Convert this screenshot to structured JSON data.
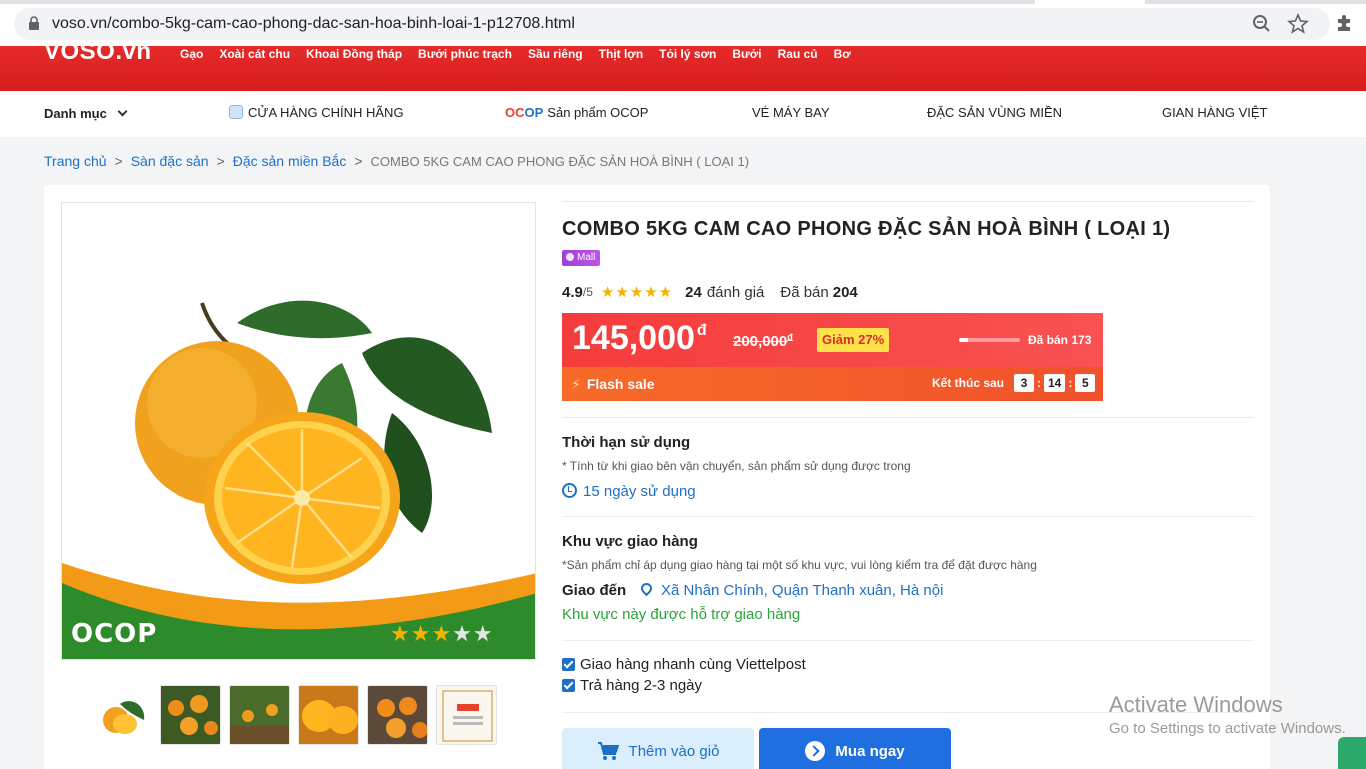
{
  "browser": {
    "url": "voso.vn/combo-5kg-cam-cao-phong-dac-san-hoa-binh-loai-1-p12708.html",
    "icons": [
      "lock-icon",
      "zoom-icon",
      "star-bookmark-icon",
      "extension-puzzle-icon"
    ]
  },
  "header": {
    "logo": "VOSO.vn",
    "links": [
      "Gạo",
      "Xoài cát chu",
      "Khoai Đồng tháp",
      "Bưởi phúc trạch",
      "Sầu riêng",
      "Thịt lợn",
      "Tỏi lý sơn",
      "Bưởi",
      "Rau củ",
      "Bơ"
    ],
    "brand_color": "#e52a2a"
  },
  "nav": {
    "danh_muc": "Danh mục",
    "store": "CỬA HÀNG CHÍNH HÃNG",
    "ocop_logo_a": "OC",
    "ocop_logo_b": "OP",
    "ocop": "Sản phẩm OCOP",
    "flights": "VÉ MÁY BAY",
    "regional": "ĐẶC SẢN VÙNG MIỀN",
    "viet": "GIAN HÀNG VIỆT"
  },
  "breadcrumb": {
    "home": "Trang chủ",
    "cat1": "Sàn đặc sản",
    "cat2": "Đặc sản miền Bắc",
    "current": "COMBO 5KG CAM CAO PHONG ĐẶC SẢN HOÀ BÌNH ( LOẠI 1)"
  },
  "product": {
    "title": "COMBO 5KG CAM CAO PHONG ĐẶC SẢN HOÀ BÌNH ( LOẠI 1)",
    "badge": "Mall",
    "rating": "4.9",
    "rating_of": "/5",
    "stars": "★★★★★",
    "review_count": "24",
    "review_label": "đánh giá",
    "sold_label": "Đã bán",
    "sold_count": "204",
    "image_text": "OCOP",
    "image_stars": "★★★★★",
    "ocop_rating": 3
  },
  "flash_sale": {
    "price": "145,000",
    "currency": "đ",
    "old_price": "200,000",
    "discount": "Giảm 27%",
    "sold_text": "Đã bán 173",
    "progress_fraction": 0.15,
    "label": "Flash sale",
    "end_label": "Kết thúc sau",
    "timer": [
      "3",
      "14",
      "5"
    ]
  },
  "usage": {
    "title": "Thời hạn sử dụng",
    "note": "* Tính từ khi giao bên vận chuyển, sản phẩm sử dụng được trong",
    "value": "15 ngày sử dụng"
  },
  "delivery": {
    "title": "Khu vực giao hàng",
    "note": "*Sản phẩm chỉ áp dụng giao hàng tại một số khu vực, vui lòng kiểm tra để đặt được hàng",
    "to_label": "Giao đến",
    "address": "Xã Nhân Chính, Quận Thanh xuân, Hà nội",
    "supported": "Khu vực này được hỗ trợ giao hàng"
  },
  "options": {
    "fast": "Giao hàng nhanh cùng Viettelpost",
    "return": "Trả hàng 2-3 ngày"
  },
  "buttons": {
    "cart": "Thêm vào giỏ",
    "buy": "Mua ngay"
  },
  "watermark": {
    "line1": "Activate Windows",
    "line2": "Go to Settings to activate Windows."
  }
}
